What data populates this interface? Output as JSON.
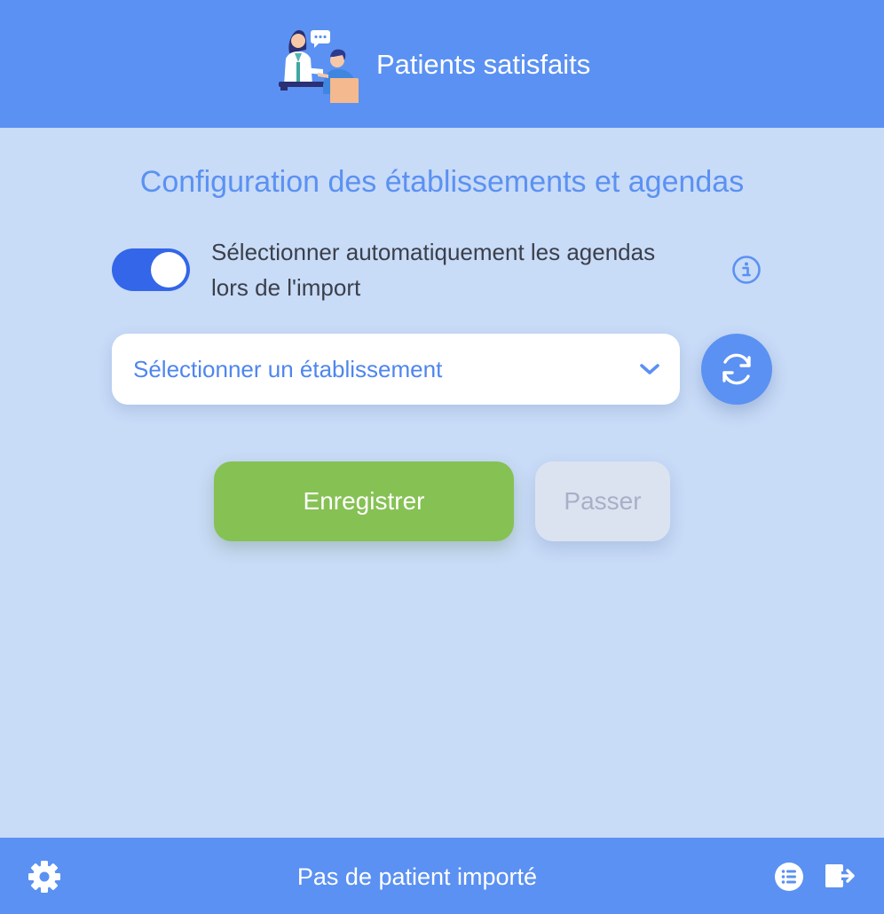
{
  "header": {
    "app_title": "Patients satisfaits",
    "logo_icon": "doctor-patient-consultation-illustration"
  },
  "main": {
    "page_title": "Configuration des établissements et agendas",
    "auto_select": {
      "enabled": true,
      "label": "Sélectionner automatiquement les agendas lors de l'import",
      "info_icon": "info-circle-icon"
    },
    "establishment_select": {
      "placeholder": "Sélectionner un établissement",
      "chevron_icon": "chevron-down-icon"
    },
    "refresh_icon": "refresh-icon",
    "save_label": "Enregistrer",
    "skip_label": "Passer"
  },
  "footer": {
    "status": "Pas de patient importé",
    "settings_icon": "gear-icon",
    "list_icon": "list-icon",
    "logout_icon": "logout-icon"
  },
  "colors": {
    "accent": "#5b91f2",
    "background": "#c8dbf7",
    "toggle_on": "#3366e8",
    "save": "#86c154",
    "skip": "#dce3f0"
  }
}
